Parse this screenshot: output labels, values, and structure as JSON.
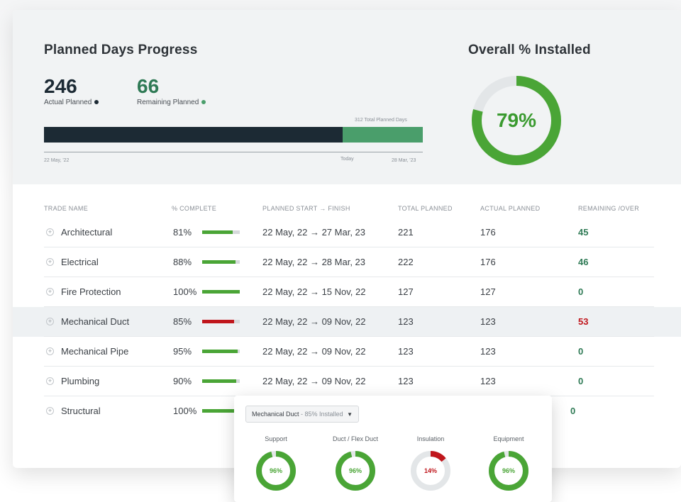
{
  "colors": {
    "dark": "#1c2a34",
    "green": "#4aa536",
    "teal": "#2f7a55",
    "red": "#c0161c",
    "track": "#d6d9dc"
  },
  "planned": {
    "title": "Planned Days Progress",
    "actual_value": "246",
    "actual_label": "Actual Planned",
    "remaining_value": "66",
    "remaining_label": "Remaining Planned",
    "total_label": "312 Total Planned Days",
    "actual_fraction": 0.788,
    "start_label": "22 May, '22",
    "today_label": "Today",
    "end_label": "28 Mar, '23"
  },
  "overall": {
    "title": "Overall % Installed",
    "value": "79%",
    "fraction": 0.79
  },
  "table": {
    "headers": [
      "TRADE NAME",
      "% COMPLETE",
      "PLANNED START → FINISH",
      "TOTAL PLANNED",
      "ACTUAL PLANNED",
      "REMAINING /OVER"
    ],
    "rows": [
      {
        "name": "Architectural",
        "pct": "81%",
        "fill": 0.81,
        "bar": "green",
        "dates": "22 May, 22 → 27 Mar, 23",
        "total": "221",
        "actual": "176",
        "rem": "45",
        "rem_color": "teal"
      },
      {
        "name": "Electrical",
        "pct": "88%",
        "fill": 0.88,
        "bar": "green",
        "dates": "22 May, 22 → 28 Mar, 23",
        "total": "222",
        "actual": "176",
        "rem": "46",
        "rem_color": "teal"
      },
      {
        "name": "Fire Protection",
        "pct": "100%",
        "fill": 1.0,
        "bar": "green",
        "dates": "22 May, 22 → 15 Nov, 22",
        "total": "127",
        "actual": "127",
        "rem": "0",
        "rem_color": "teal"
      },
      {
        "name": "Mechanical Duct",
        "pct": "85%",
        "fill": 0.85,
        "bar": "red",
        "dates": "22 May, 22 → 09 Nov, 22",
        "total": "123",
        "actual": "123",
        "rem": "53",
        "rem_color": "red",
        "highlight": true
      },
      {
        "name": "Mechanical Pipe",
        "pct": "95%",
        "fill": 0.95,
        "bar": "green",
        "dates": "22 May, 22 → 09 Nov, 22",
        "total": "123",
        "actual": "123",
        "rem": "0",
        "rem_color": "teal"
      },
      {
        "name": "Plumbing",
        "pct": "90%",
        "fill": 0.9,
        "bar": "green",
        "dates": "22 May, 22 → 09 Nov, 22",
        "total": "123",
        "actual": "123",
        "rem": "0",
        "rem_color": "teal"
      },
      {
        "name": "Structural",
        "pct": "100%",
        "fill": 1.0,
        "bar": "green",
        "dates": "",
        "total": "",
        "actual": "",
        "rem": "0",
        "rem_color": "teal"
      }
    ]
  },
  "popup": {
    "dropdown_main": "Mechanical Duct",
    "dropdown_sub": " - 85% Installed",
    "items": [
      {
        "label": "Support",
        "value": "96%",
        "fraction": 0.96,
        "color": "green"
      },
      {
        "label": "Duct / Flex Duct",
        "value": "96%",
        "fraction": 0.96,
        "color": "green"
      },
      {
        "label": "Insulation",
        "value": "14%",
        "fraction": 0.14,
        "color": "red"
      },
      {
        "label": "Equipment",
        "value": "96%",
        "fraction": 0.96,
        "color": "green"
      }
    ]
  }
}
